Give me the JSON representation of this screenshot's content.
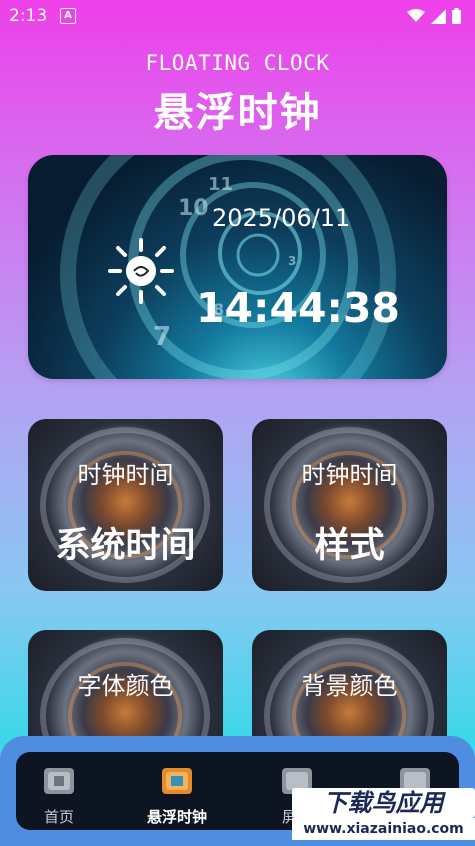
{
  "status_bar": {
    "time": "2:13",
    "notif_letter": "A"
  },
  "header": {
    "title_en": "FLOATING CLOCK",
    "title_cn": "悬浮时钟"
  },
  "hero": {
    "date": "2025/06/11",
    "time": "14:44:38"
  },
  "cards": [
    {
      "small": "时钟时间",
      "big": "系统时间"
    },
    {
      "small": "时钟时间",
      "big": "样式"
    },
    {
      "small": "字体颜色",
      "big": ""
    },
    {
      "small": "背景颜色",
      "big": ""
    }
  ],
  "nav": {
    "items": [
      {
        "label": "首页",
        "icon": "home-box-icon"
      },
      {
        "label": "悬浮时钟",
        "icon": "floating-clock-box-icon",
        "active": true
      },
      {
        "label": "屏幕",
        "icon": "screen-box-icon"
      },
      {
        "label": "",
        "icon": "mine-box-icon"
      }
    ]
  },
  "watermark": {
    "top": "下载鸟应用",
    "bottom": "www.xiazainiao.com"
  },
  "colors": {
    "accent_top": "#ee3fe9",
    "accent_bottom": "#2fd6e4",
    "nav_bg": "#0d1422",
    "nav_frame": "#4f8de0"
  }
}
